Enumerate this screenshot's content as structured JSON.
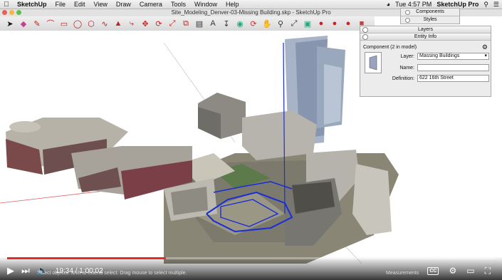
{
  "menubar": {
    "items": [
      "SketchUp",
      "File",
      "Edit",
      "View",
      "Draw",
      "Camera",
      "Tools",
      "Window",
      "Help"
    ],
    "clock": "Tue 4:57 PM",
    "app_right": "SketchUp Pro"
  },
  "window": {
    "title": "Site_Modeling_Denver-03-Missing Building.skp - SketchUp Pro"
  },
  "tray": {
    "components_label": "Components",
    "styles_label": "Styles"
  },
  "entity_panel": {
    "layers_label": "Layers",
    "entity_info_label": "Entity Info",
    "selection_summary": "Component (2 in model)",
    "layer_label": "Layer:",
    "layer_value": "Massing Buildings",
    "name_label": "Name:",
    "name_value": "",
    "definition_label": "Definition:",
    "definition_value": "622 16th Street"
  },
  "video": {
    "current_time": "19:34",
    "separator": "/",
    "duration": "1:00:02",
    "played_fraction": 0.326,
    "cc_label": "CC"
  },
  "statusbar": {
    "hint": "Select objects. Shift to extend select. Drag mouse to select multiple.",
    "measurements_label": "Measurements"
  },
  "colors": {
    "progress": "#e52d27",
    "selection": "#1a2dd6"
  }
}
